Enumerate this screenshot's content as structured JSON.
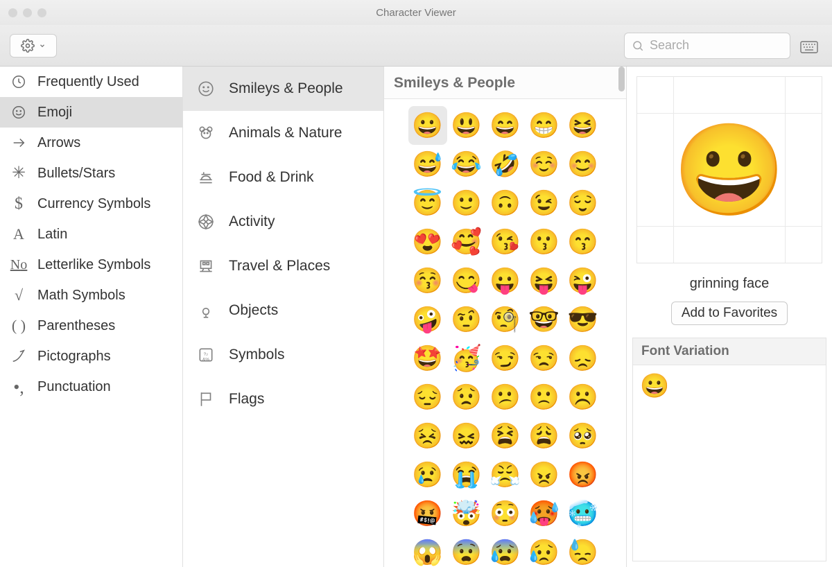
{
  "window": {
    "title": "Character Viewer"
  },
  "toolbar": {
    "search_placeholder": "Search",
    "gear_label": "Options",
    "keyboard_label": "Keyboard"
  },
  "sidebar": {
    "items": [
      {
        "icon": "clock",
        "label": "Frequently Used",
        "selected": false
      },
      {
        "icon": "smiley",
        "label": "Emoji",
        "selected": true
      },
      {
        "icon": "arrow",
        "label": "Arrows",
        "selected": false
      },
      {
        "icon": "asterisk",
        "label": "Bullets/Stars",
        "selected": false
      },
      {
        "icon": "dollar",
        "label": "Currency Symbols",
        "selected": false
      },
      {
        "icon": "A",
        "label": "Latin",
        "selected": false
      },
      {
        "icon": "numero",
        "label": "Letterlike Symbols",
        "selected": false
      },
      {
        "icon": "sqrt",
        "label": "Math Symbols",
        "selected": false
      },
      {
        "icon": "parens",
        "label": "Parentheses",
        "selected": false
      },
      {
        "icon": "quill",
        "label": "Pictographs",
        "selected": false
      },
      {
        "icon": "dots",
        "label": "Punctuation",
        "selected": false
      }
    ]
  },
  "subcategories": {
    "items": [
      {
        "label": "Smileys & People",
        "selected": true
      },
      {
        "label": "Animals & Nature",
        "selected": false
      },
      {
        "label": "Food & Drink",
        "selected": false
      },
      {
        "label": "Activity",
        "selected": false
      },
      {
        "label": "Travel & Places",
        "selected": false
      },
      {
        "label": "Objects",
        "selected": false
      },
      {
        "label": "Symbols",
        "selected": false
      },
      {
        "label": "Flags",
        "selected": false
      }
    ]
  },
  "grid": {
    "header": "Smileys & People",
    "selected_index": 0,
    "items": [
      "😀",
      "😃",
      "😄",
      "😁",
      "😆",
      "😅",
      "😂",
      "🤣",
      "☺️",
      "😊",
      "😇",
      "🙂",
      "🙃",
      "😉",
      "😌",
      "😍",
      "🥰",
      "😘",
      "😗",
      "😙",
      "😚",
      "😋",
      "😛",
      "😝",
      "😜",
      "🤪",
      "🤨",
      "🧐",
      "🤓",
      "😎",
      "🤩",
      "🥳",
      "😏",
      "😒",
      "😞",
      "😔",
      "😟",
      "😕",
      "🙁",
      "☹️",
      "😣",
      "😖",
      "😫",
      "😩",
      "🥺",
      "😢",
      "😭",
      "😤",
      "😠",
      "😡",
      "🤬",
      "🤯",
      "😳",
      "🥵",
      "🥶",
      "😱",
      "😨",
      "😰",
      "😥",
      "😓"
    ]
  },
  "preview": {
    "glyph": "😀",
    "name": "grinning face",
    "favorites_label": "Add to Favorites"
  },
  "font_variation": {
    "header": "Font Variation",
    "glyph": "😀"
  }
}
